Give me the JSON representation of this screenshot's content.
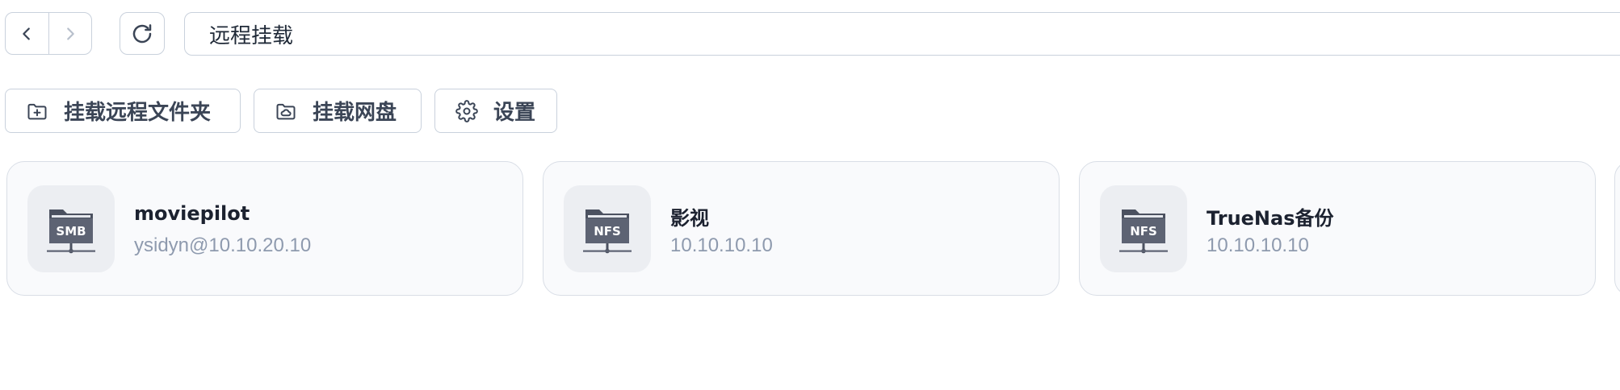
{
  "navigation": {
    "back_icon": "chevron-left-icon",
    "forward_icon": "chevron-right-icon",
    "refresh_icon": "refresh-icon"
  },
  "address_bar": {
    "value": "远程挂载"
  },
  "toolbar": {
    "mount_folder_label": "挂载远程文件夹",
    "mount_folder_icon": "folder-plus-icon",
    "mount_cloud_label": "挂载网盘",
    "mount_cloud_icon": "cloud-folder-icon",
    "settings_label": "设置",
    "settings_icon": "gear-icon"
  },
  "mounts": [
    {
      "name": "moviepilot",
      "address": "ysidyn@10.10.20.10",
      "protocol": "SMB"
    },
    {
      "name": "影视",
      "address": "10.10.10.10",
      "protocol": "NFS"
    },
    {
      "name": "TrueNas备份",
      "address": "10.10.10.10",
      "protocol": "NFS"
    }
  ],
  "colors": {
    "border": "#c9d1dc",
    "card_background": "#f9fafc",
    "icon_tile": "#eceef2",
    "folder_dark": "#4b5160",
    "subtitle": "#8e9aae"
  }
}
